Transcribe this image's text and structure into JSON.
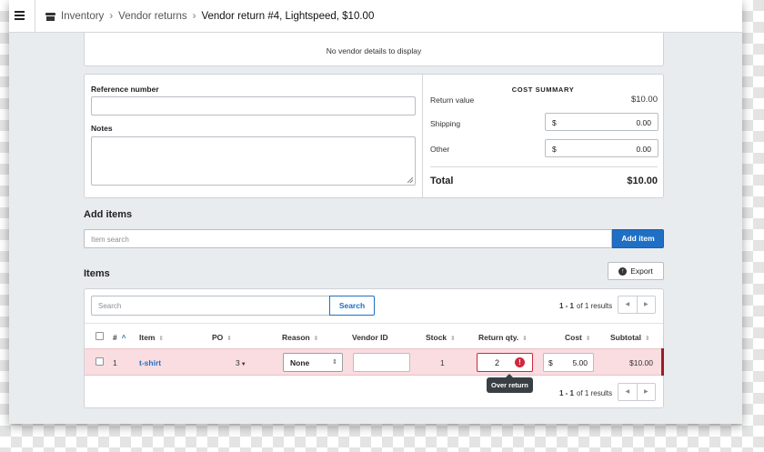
{
  "breadcrumb": {
    "items": [
      "Inventory",
      "Vendor returns"
    ],
    "current": "Vendor return #4, Lightspeed, $10.00"
  },
  "vendor": {
    "empty_message": "No vendor details to display"
  },
  "details": {
    "reference_label": "Reference number",
    "reference_value": "",
    "notes_label": "Notes",
    "notes_value": ""
  },
  "cost_summary": {
    "title": "COST SUMMARY",
    "return_value_label": "Return value",
    "return_value": "$10.00",
    "shipping_label": "Shipping",
    "shipping_currency": "$",
    "shipping_value": "0.00",
    "other_label": "Other",
    "other_currency": "$",
    "other_value": "0.00",
    "total_label": "Total",
    "total_value": "$10.00"
  },
  "add_items": {
    "title": "Add items",
    "search_placeholder": "Item search",
    "button": "Add item"
  },
  "items": {
    "title": "Items",
    "export_label": "Export",
    "search_placeholder": "Search",
    "search_button": "Search",
    "pagination": {
      "range": "1 - 1",
      "text": "of 1 results"
    },
    "columns": [
      "#",
      "Item",
      "PO",
      "Reason",
      "Vendor ID",
      "Stock",
      "Return qty.",
      "Cost",
      "Subtotal"
    ],
    "rows": [
      {
        "index": "1",
        "item": "t-shirt",
        "po": "3",
        "reason": "None",
        "vendor_id": "",
        "stock": "1",
        "return_qty": "2",
        "cost_currency": "$",
        "cost": "5.00",
        "subtotal": "$10.00",
        "error": "Over return"
      }
    ]
  },
  "colors": {
    "accent": "#1f6fc5",
    "error": "#d1283c",
    "error_row_bg": "#f9dde0"
  }
}
